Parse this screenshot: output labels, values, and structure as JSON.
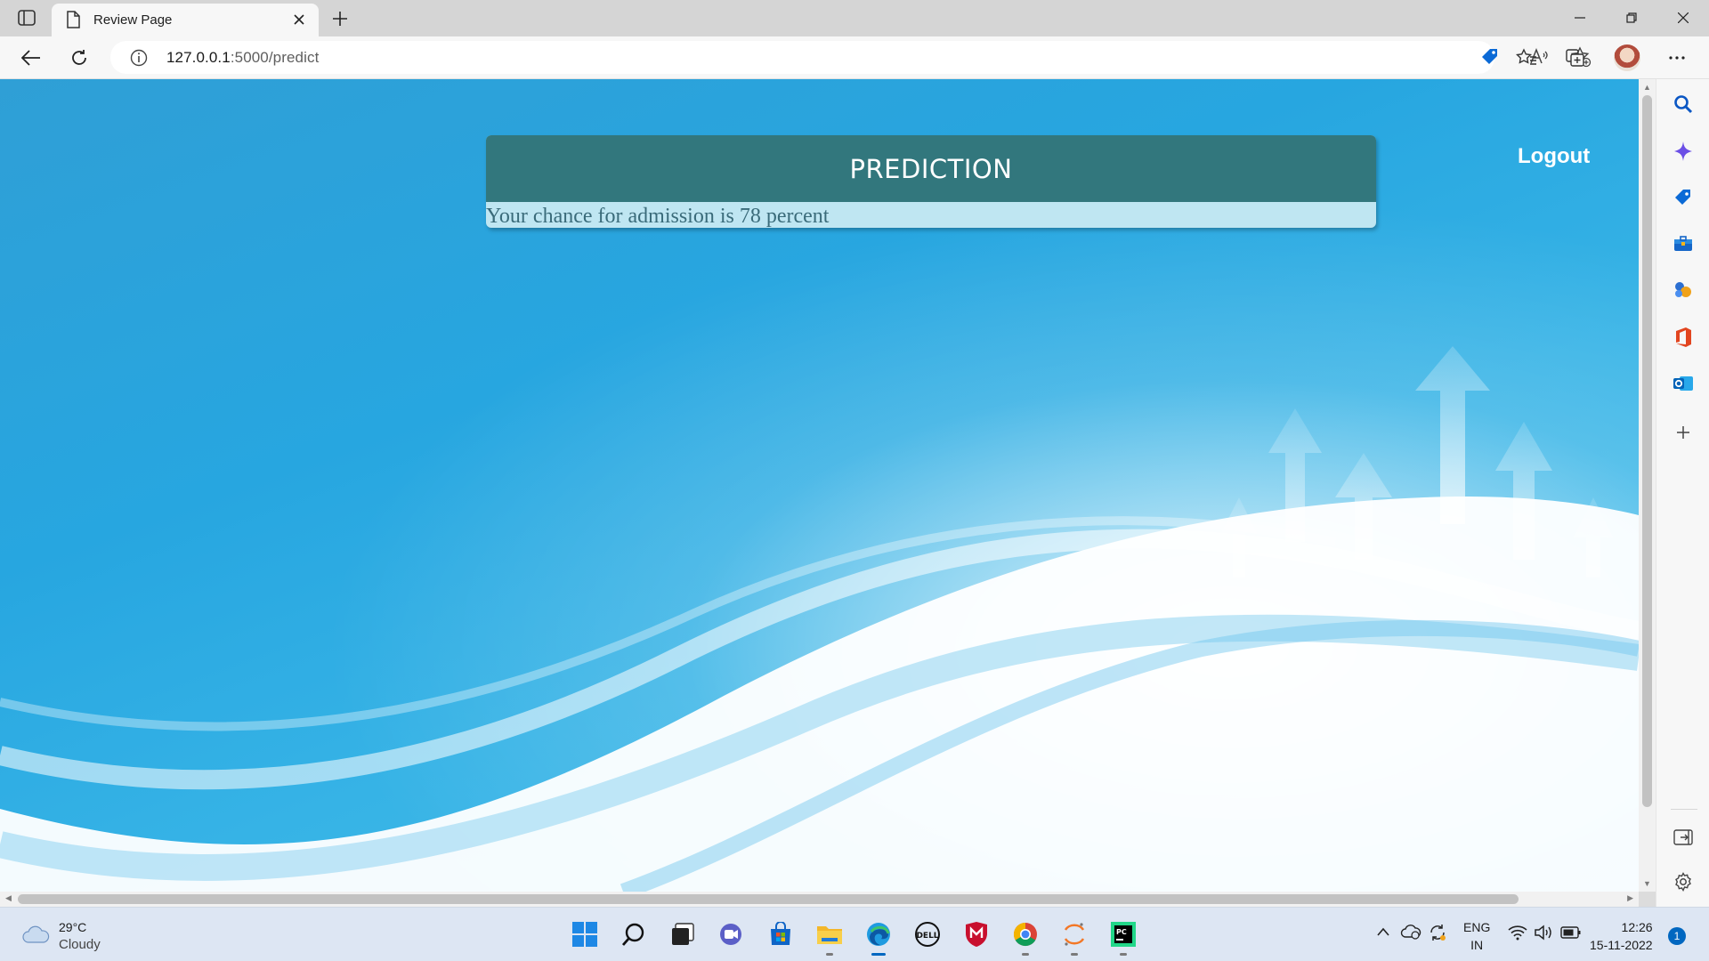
{
  "browser": {
    "tab_title": "Review Page",
    "url_host": "127.0.0.1",
    "url_rest": ":5000/predict"
  },
  "page": {
    "card_title": "PREDICTION",
    "result_text": "Your chance for admission is 78 percent",
    "logout_label": "Logout"
  },
  "taskbar": {
    "weather_temp": "29°C",
    "weather_condition": "Cloudy",
    "lang_line1": "ENG",
    "lang_line2": "IN",
    "time": "12:26",
    "date": "15-11-2022",
    "notification_count": "1"
  },
  "colors": {
    "card_header": "#32777d",
    "page_bg": "#27a6e0",
    "accent": "#0067c0"
  }
}
